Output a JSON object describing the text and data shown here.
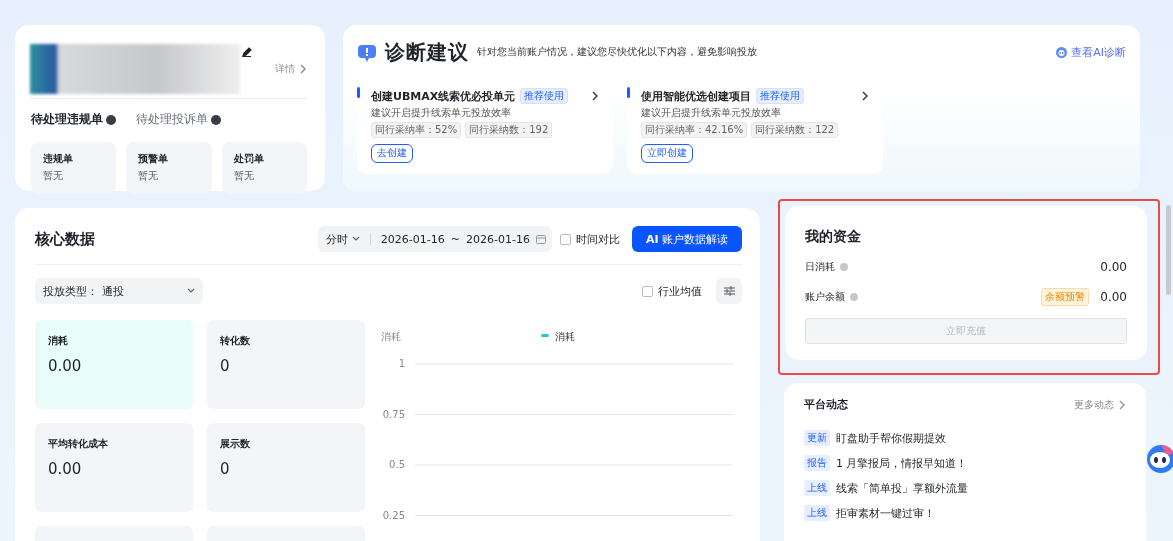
{
  "profile": {
    "detail_link": "详情",
    "tabs": [
      {
        "label": "待处理违规单",
        "selected": true
      },
      {
        "label": "待处理投诉单",
        "selected": false
      }
    ],
    "tiles": [
      {
        "title": "违规单",
        "value": "暂无"
      },
      {
        "title": "预警单",
        "value": "暂无"
      },
      {
        "title": "处罚单",
        "value": "暂无"
      }
    ]
  },
  "diagnosis": {
    "title": "诊断建议",
    "subtitle": "针对您当前账户情况，建议您尽快优化以下内容，避免影响投放",
    "ai_link": "查看AI诊断",
    "suggestions": [
      {
        "title": "创建UBMAX线索优必投单元",
        "tag": "推荐使用",
        "description": "建议开启提升线索单元投放效率",
        "stats": [
          "同行采纳率：52%",
          "同行采纳数：192"
        ],
        "button": "去创建"
      },
      {
        "title": "使用智能优选创建项目",
        "tag": "推荐使用",
        "description": "建议开启提升线索单元投放效率",
        "stats": [
          "同行采纳率：42.16%",
          "同行采纳数：122"
        ],
        "button": "立即创建"
      }
    ]
  },
  "core_data": {
    "title": "核心数据",
    "granularity": "分时",
    "date_start": "2026-01-16",
    "date_separator": "~",
    "date_end": "2026-01-16",
    "compare": {
      "label": "时间对比",
      "checked": false
    },
    "ai_button": {
      "prefix": "AI",
      "label": "账户数据解读"
    },
    "filter": {
      "label": "投放类型：",
      "value": "通投"
    },
    "industry_avg": {
      "label": "行业均值",
      "checked": false
    },
    "metrics": [
      {
        "label": "消耗",
        "value": "0.00",
        "selected": true
      },
      {
        "label": "转化数",
        "value": "0",
        "selected": false
      },
      {
        "label": "平均转化成本",
        "value": "0.00",
        "selected": false
      },
      {
        "label": "展示数",
        "value": "0",
        "selected": false
      },
      {
        "selected": false
      },
      {
        "selected": false
      }
    ],
    "chart_data": {
      "type": "line",
      "ylabel": "消耗",
      "grid": true,
      "ylim": [
        0.25,
        1
      ],
      "yticks": [
        1,
        0.75,
        0.5,
        0.25
      ],
      "series": [
        {
          "name": "消耗",
          "color": "#20c9d6"
        }
      ]
    }
  },
  "funds": {
    "title": "我的资金",
    "highlighted": true,
    "rows": [
      {
        "label": "日消耗",
        "value": "0.00"
      },
      {
        "label": "账户余额",
        "badge": "余额预警",
        "value": "0.00"
      }
    ],
    "button": {
      "label": "立即充值",
      "disabled": true
    }
  },
  "news": {
    "title": "平台动态",
    "more": "更多动态",
    "items": [
      {
        "tag": "更新",
        "text": "盯盘助手帮你假期提效"
      },
      {
        "tag": "报告",
        "text": "1 月擎报局，情报早知道！"
      },
      {
        "tag": "上线",
        "text": "线索「简单投」享额外流量"
      },
      {
        "tag": "上线",
        "text": "拒审素材一键过审！"
      }
    ]
  }
}
